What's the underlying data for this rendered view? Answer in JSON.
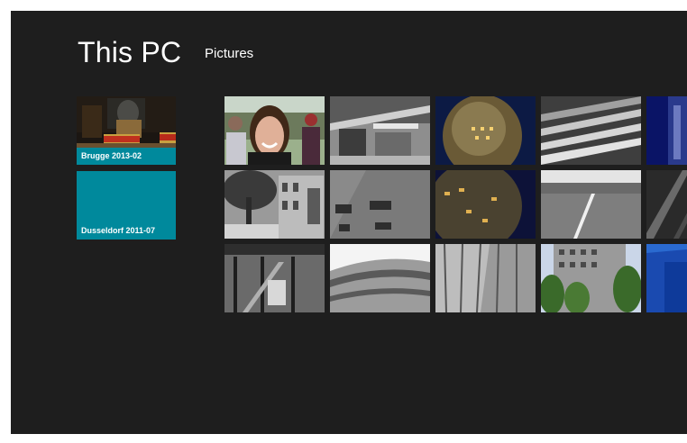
{
  "header": {
    "title": "This PC",
    "breadcrumb": "Pictures"
  },
  "folders": [
    {
      "label": "Brugge 2013-02",
      "has_preview": true
    },
    {
      "label": "Dusseldorf 2011-07",
      "has_preview": false
    }
  ],
  "colors": {
    "background": "#1e1e1e",
    "accent": "#00899c",
    "text": "#ffffff"
  },
  "photos": [
    {
      "subject": "portrait of smiling person at outdoor market"
    },
    {
      "subject": "black and white market hall interior"
    },
    {
      "subject": "spherical dome at night with lit windows"
    },
    {
      "subject": "stadium seating rows in black and white"
    },
    {
      "subject": "blue night building, cropped"
    },
    {
      "subject": "tree and old street buildings in black and white"
    },
    {
      "subject": "brick facade with windows in black and white"
    },
    {
      "subject": "close-up of sphere surface with lit windows"
    },
    {
      "subject": "empty stadium field in black and white"
    },
    {
      "subject": "dark angled structure, cropped"
    },
    {
      "subject": "steel framed building interior"
    },
    {
      "subject": "curved modern building facade"
    },
    {
      "subject": "glass skyscraper facade"
    },
    {
      "subject": "apartment block with trees"
    },
    {
      "subject": "blue modern building, cropped"
    }
  ]
}
